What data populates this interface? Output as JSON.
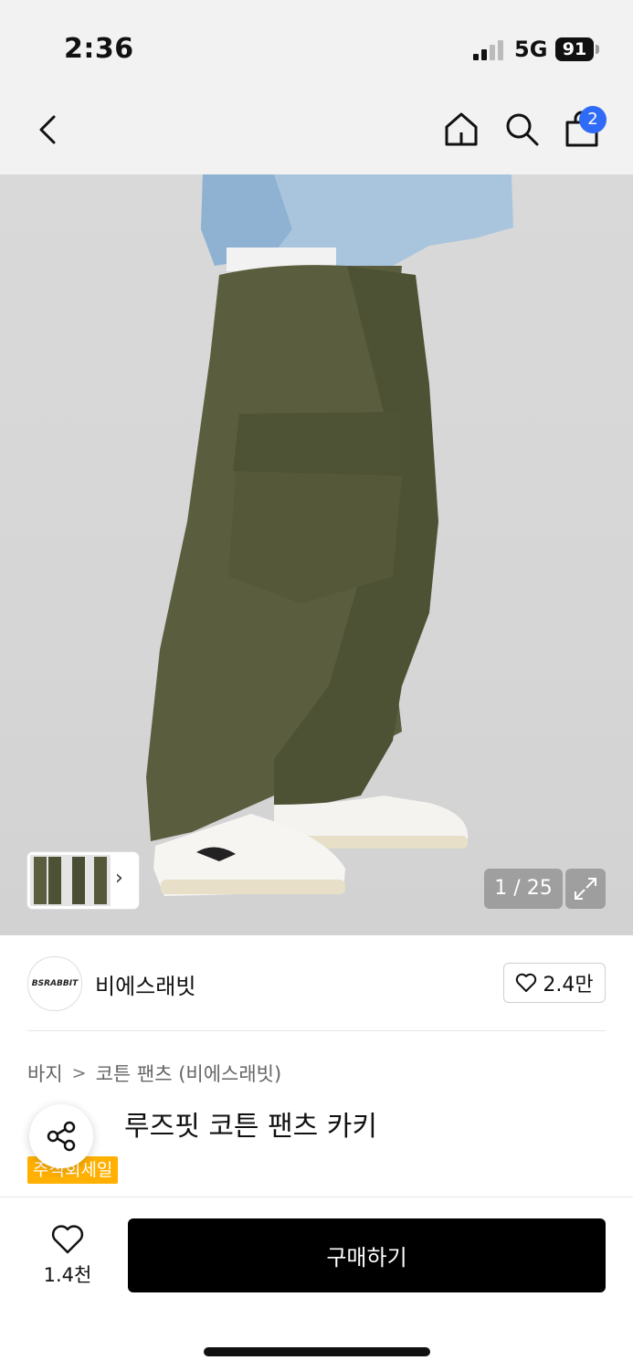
{
  "status_bar": {
    "time": "2:36",
    "network": "5G",
    "battery": "91"
  },
  "nav": {
    "cart_count": "2",
    "icons": [
      "chevron-left-icon",
      "home-icon",
      "search-icon",
      "shopping-bag-icon"
    ]
  },
  "gallery": {
    "counter": "1 / 25",
    "thumb_arrow": "›"
  },
  "brand": {
    "logo_text": "BSRABBIT",
    "name": "비에스래빗",
    "like_count": "2.4만"
  },
  "breadcrumb": {
    "category": "바지",
    "separator": ">",
    "subcategory": "코튼 팬츠 (비에스래빗)"
  },
  "product": {
    "title": "루즈핏 코튼 팬츠 카키",
    "sale_tag": "주식회세일"
  },
  "bottom": {
    "like_count": "1.4천",
    "buy_label": "구매하기"
  },
  "colors": {
    "accent_blue": "#2f6bf6",
    "sale_tag": "#ffb000",
    "buy_button": "#000000"
  }
}
